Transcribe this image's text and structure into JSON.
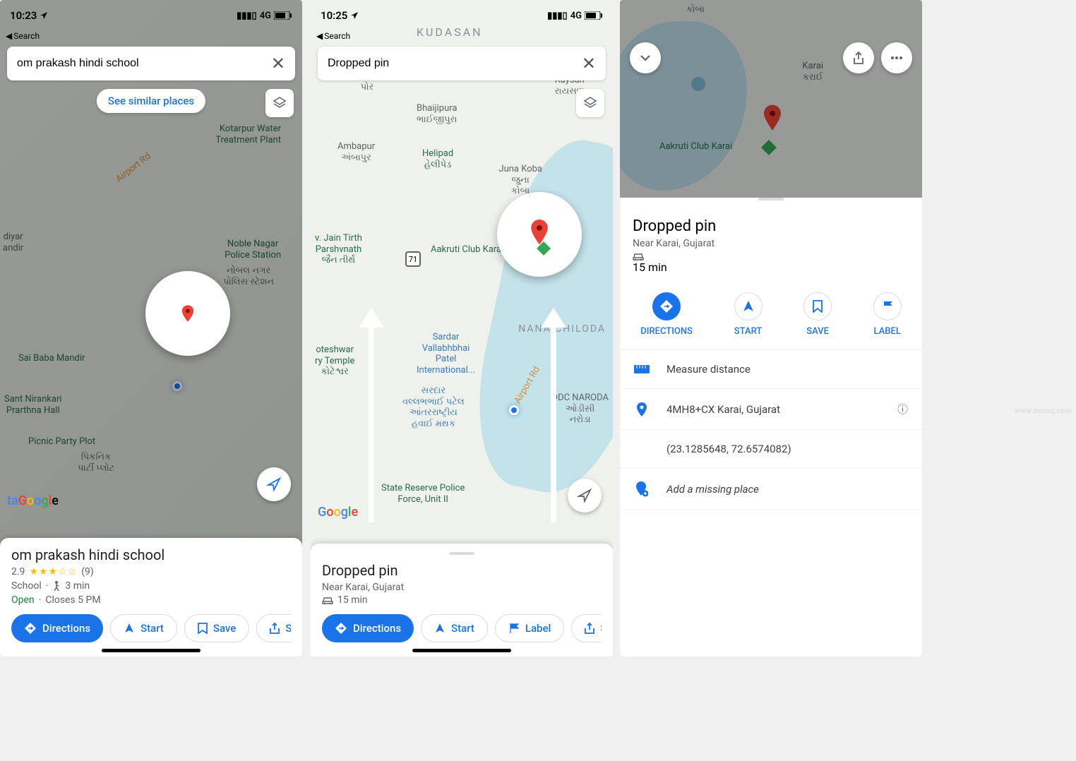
{
  "screen1": {
    "status": {
      "time": "10:23",
      "back": "Search",
      "net": "4G"
    },
    "search": {
      "query": "om prakash hindi school"
    },
    "chip": "See similar places",
    "map_labels": {
      "kotarpur": "Kotarpur Water\nTreatment Plant",
      "noble": "Noble Nagar\nPolice Station",
      "noble_gu": "નોબલ નગર\nપોલિસ સ્ટેશન",
      "sai": "Sai Baba Mandir",
      "nirankari": "Sant Nirankari\nPrarthna Hall",
      "picnic": "Picnic Party Plot",
      "picnic_gu": "પિકનિક\nપાર્ટી પ્લોટ",
      "diyar": "diyar\nandir",
      "road": "Airport Rd",
      "ta": "ta"
    },
    "place": {
      "title": "om prakash hindi school",
      "rating": "2.9",
      "reviews": "(9)",
      "category": "School",
      "walk": "3 min",
      "open": "Open",
      "closes": "Closes 5 PM"
    },
    "buttons": {
      "directions": "Directions",
      "start": "Start",
      "save": "Save",
      "share": "Sh"
    }
  },
  "screen2": {
    "status": {
      "time": "10:25",
      "back": "Search",
      "net": "4G"
    },
    "search": {
      "query": "Dropped pin"
    },
    "map_labels": {
      "kudasan": "KUDASAN",
      "por": "Por\nપોર",
      "bhaijipura": "Bhaijipura\nભાઈજીપુરા",
      "raysan": "Raysan\nરાયસણ",
      "ambapur": "Ambapur\nઅંબાપુર",
      "helipad": "Helipad\nહેલીપેડ",
      "juna": "Juna Koba\nજુના\nકોબા",
      "jain": "v. Jain Tirth\nParshvnath\nજૈન તીર્થ",
      "aakruti": "Aakruti Club Karai",
      "sardar": "Sardar\nVallabhbhai\nPatel\nInternational...",
      "sardar_gu": "સરદાર\nવલ્લભભાઈ પટેલ\nઆંતરરાષ્ટ્રીય\nહવાઈ મથક",
      "nana": "NANA CHILODA",
      "naroda": "ODC NARODA\nઓડીસી\nનરોડા",
      "road": "Airport Rd",
      "oteshwar": "oteshwar\nry Temple\nકોટેશ્વર",
      "reserve": "State Reserve Police\nForce, Unit II"
    },
    "place": {
      "title": "Dropped pin",
      "near": "Near Karai, Gujarat",
      "drive": "15 min"
    },
    "buttons": {
      "directions": "Directions",
      "start": "Start",
      "label": "Label",
      "share": "Sh"
    }
  },
  "screen3": {
    "map_labels": {
      "karai": "Karai\nકરાઈ",
      "koba": "કોબા",
      "aakruti": "Aakruti Club Karai"
    },
    "sheet": {
      "title": "Dropped pin",
      "near": "Near Karai, Gujarat",
      "drive": "15 min"
    },
    "actions": {
      "directions": "DIRECTIONS",
      "start": "START",
      "save": "SAVE",
      "label": "LABEL"
    },
    "rows": {
      "measure": "Measure distance",
      "pluscode": "4MH8+CX Karai, Gujarat",
      "coords": "(23.1285648, 72.6574082)",
      "missing": "Add a missing place"
    }
  },
  "watermark": "www.deuaq.com"
}
